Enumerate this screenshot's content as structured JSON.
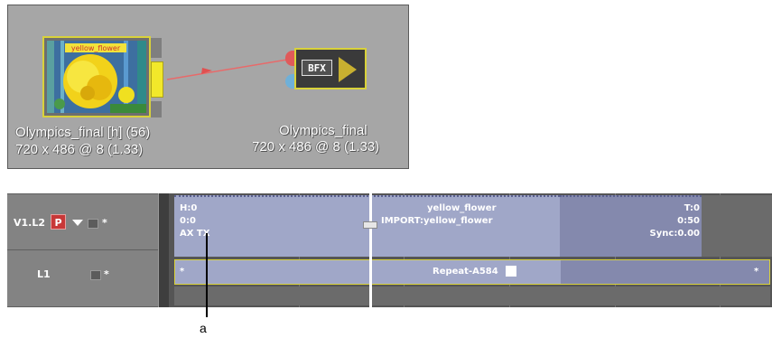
{
  "schematic": {
    "source_node": {
      "name": "Olympics_final [h] (56)",
      "dims": "720 x 486 @ 8 (1.33)"
    },
    "bfx_node": {
      "label": "BFX",
      "name": "Olympics_final",
      "dims": "720 x 486 @ 8 (1.33)"
    },
    "colors": {
      "panel": "#a6a6a6",
      "connector": "#e86a6a",
      "node_border": "#d9d23a",
      "output_tab": "#f2e82a"
    }
  },
  "timeline": {
    "tracks": [
      {
        "label": "V1.L2",
        "badge": "P",
        "star": "*"
      },
      {
        "label": "L1",
        "star": "*"
      }
    ],
    "clip": {
      "head": "H:0",
      "offset": "0:0",
      "flags": "AX TX",
      "name": "yellow_flower",
      "import": "IMPORT:yellow_flower",
      "tail": "T:0",
      "end": "0:50",
      "sync": "Sync:0.00"
    },
    "repeat_clip": {
      "label": "Repeat-A584",
      "star_left": "*",
      "star_right": "*"
    },
    "colors": {
      "clip": "#a0a7c8",
      "clip_dark": "#8489ad",
      "track_bg": "#555555",
      "header_bg": "#838383",
      "badge": "#c83838"
    }
  },
  "callout": {
    "label": "a"
  }
}
